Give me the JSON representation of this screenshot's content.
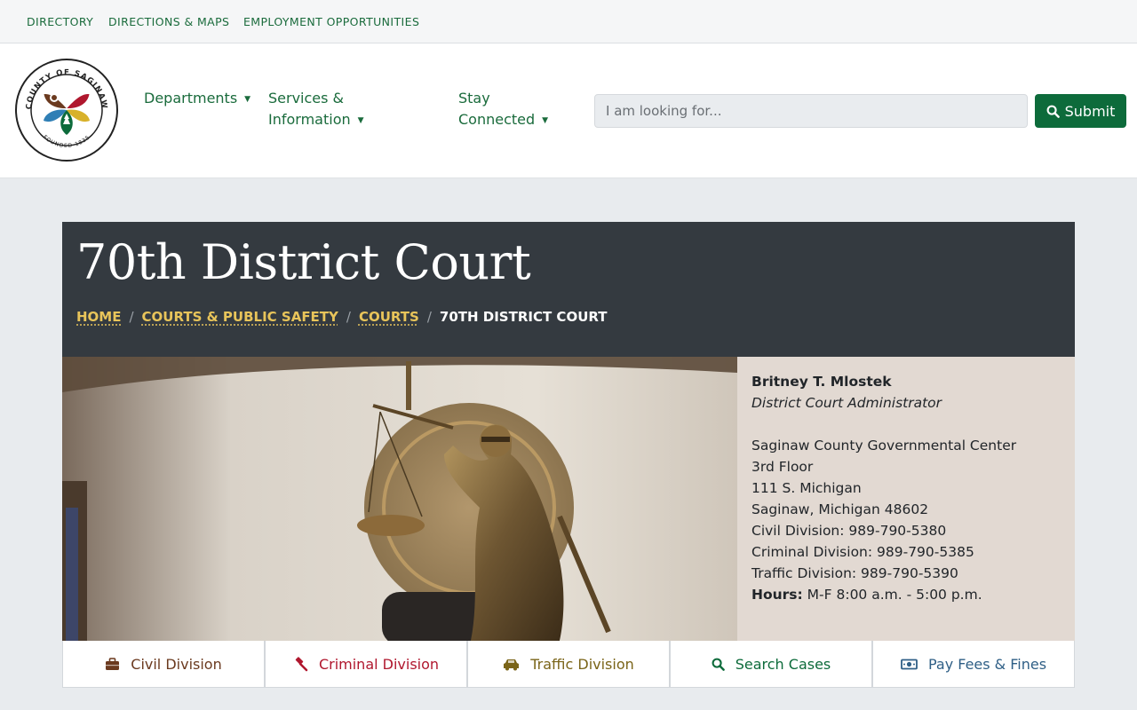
{
  "utility_links": [
    {
      "label": "DIRECTORY"
    },
    {
      "label": "DIRECTIONS & MAPS"
    },
    {
      "label": "EMPLOYMENT OPPORTUNITIES"
    }
  ],
  "logo": {
    "top_text": "COUNTY OF SAGINAW",
    "bottom_text": "FOUNDED 1835"
  },
  "nav": {
    "departments": "Departments",
    "services_1": "Services &",
    "services_2": "Information",
    "stay_1": "Stay",
    "stay_2": "Connected"
  },
  "search": {
    "placeholder": "I am looking for...",
    "submit_label": "Submit"
  },
  "hero": {
    "title": "70th District Court",
    "breadcrumbs": [
      "HOME",
      "COURTS & PUBLIC SAFETY",
      "COURTS"
    ],
    "current": "70TH DISTRICT COURT"
  },
  "contact": {
    "name": "Britney T. Mlostek",
    "role": "District Court Administrator",
    "building": "Saginaw County Governmental Center",
    "floor": "3rd Floor",
    "street": "111 S. Michigan",
    "city": "Saginaw, Michigan 48602",
    "civil": "Civil Division: 989-790-5380",
    "criminal": "Criminal Division: 989-790-5385",
    "traffic": "Traffic Division: 989-790-5390",
    "hours_label": "Hours:",
    "hours_value": "M-F 8:00 a.m. - 5:00 p.m."
  },
  "quick_links": [
    {
      "label": "Civil Division",
      "icon": "briefcase-icon",
      "color": "#6b3a1f"
    },
    {
      "label": "Criminal Division",
      "icon": "gavel-icon",
      "color": "#b0172e"
    },
    {
      "label": "Traffic Division",
      "icon": "car-icon",
      "color": "#7a6418"
    },
    {
      "label": "Search Cases",
      "icon": "search-icon",
      "color": "#0d6b3b"
    },
    {
      "label": "Pay Fees & Fines",
      "icon": "money-icon",
      "color": "#2f5f86"
    }
  ],
  "colors": {
    "brand_green": "#0d6b3b",
    "title_band": "#343a40",
    "breadcrumb_gold": "#e8c45a",
    "info_panel": "#e2d9d2"
  }
}
